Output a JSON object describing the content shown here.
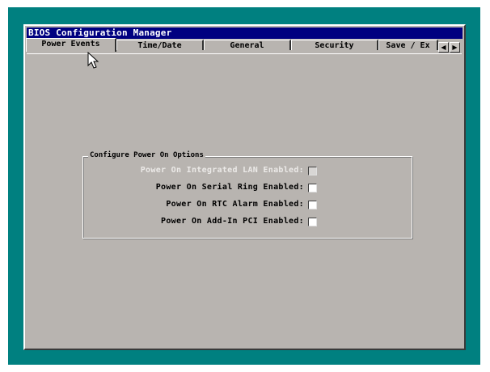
{
  "window": {
    "title": "BIOS Configuration Manager"
  },
  "tabs": [
    {
      "label": "Power Events",
      "active": true
    },
    {
      "label": "Time/Date",
      "active": false
    },
    {
      "label": "General",
      "active": false
    },
    {
      "label": "Security",
      "active": false
    },
    {
      "label": "Save / Ex",
      "active": false
    }
  ],
  "tab_scroll": {
    "left_icon": "arrow-left-icon",
    "right_icon": "arrow-right-icon"
  },
  "group": {
    "title": "Configure Power On Options",
    "options": [
      {
        "label": "Power On Integrated LAN Enabled:",
        "checked": false,
        "enabled": false
      },
      {
        "label": "Power On Serial Ring Enabled:",
        "checked": false,
        "enabled": true
      },
      {
        "label": "Power On RTC Alarm Enabled:",
        "checked": false,
        "enabled": true
      },
      {
        "label": "Power On Add-In PCI Enabled:",
        "checked": false,
        "enabled": true
      }
    ]
  },
  "colors": {
    "desktop": "#008080",
    "titlebar": "#000080",
    "panel": "#b8b4b0"
  }
}
